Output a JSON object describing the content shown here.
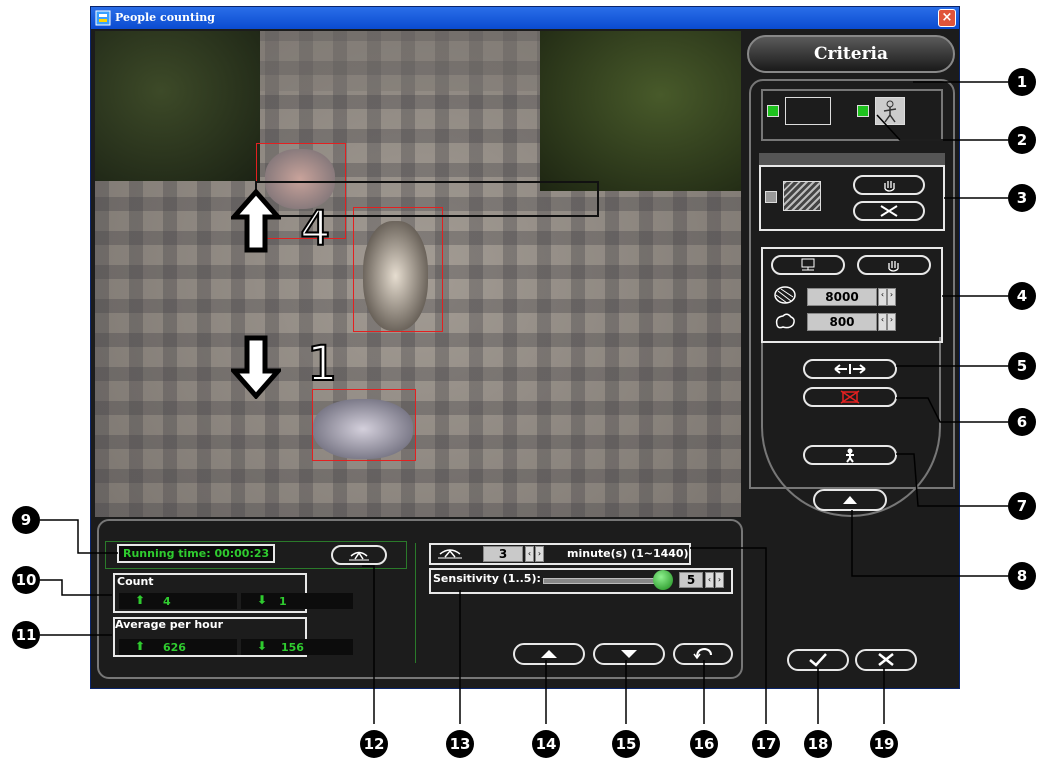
{
  "window": {
    "title": "People counting",
    "close_label": "×"
  },
  "video": {
    "up_count": "4",
    "down_count": "1"
  },
  "criteria": {
    "tab_label": "Criteria",
    "area_max": "8000",
    "area_min": "800"
  },
  "stats": {
    "running_time": "Running time: 00:00:23",
    "count_label": "Count",
    "count_up": "4",
    "count_down": "1",
    "avg_label": "Average per hour",
    "avg_up": "626",
    "avg_down": "156"
  },
  "settings": {
    "interval_value": "3",
    "interval_unit": "minute(s) (1~1440)",
    "sensitivity_label": "Sensitivity (1..5):",
    "sensitivity_value": "5",
    "sensitivity_level": 5
  },
  "callouts": [
    "1",
    "2",
    "3",
    "4",
    "5",
    "6",
    "7",
    "8",
    "9",
    "10",
    "11",
    "12",
    "13",
    "14",
    "15",
    "16",
    "17",
    "18",
    "19"
  ],
  "colors": {
    "titlebar": "#0a4bd0",
    "accent_green": "#2fcb2f",
    "box_red": "#e32020"
  },
  "icons": [
    "app-icon",
    "person-icon",
    "hand-icon",
    "cancel-x-icon",
    "monitor-icon",
    "large-blob-icon",
    "small-blob-icon",
    "split-arrows-icon",
    "red-box-icon",
    "figure-icon",
    "up-arrow-icon",
    "down-arrow-icon",
    "undo-icon",
    "reset-icon",
    "check-icon",
    "close-x-icon"
  ]
}
